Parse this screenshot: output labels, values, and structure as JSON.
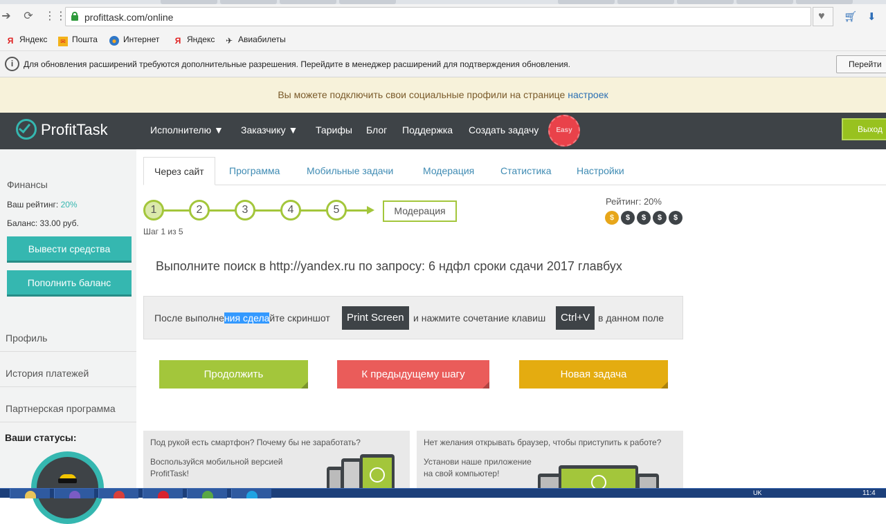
{
  "browser": {
    "url": "profittask.com/online",
    "bookmarks": [
      {
        "label": "Яндекс",
        "icon": "yandex-icon"
      },
      {
        "label": "Пошта",
        "icon": "mail-icon"
      },
      {
        "label": "Интернет",
        "icon": "internet-icon"
      },
      {
        "label": "Яндекс",
        "icon": "yandex-icon"
      },
      {
        "label": "Авиабилеты",
        "icon": "plane-icon"
      }
    ],
    "notice_text": "Для обновления расширений требуются дополнительные разрешения. Перейдите в менеджер расширений для подтверждения обновления.",
    "notice_button": "Перейти"
  },
  "banner": {
    "text": "Вы можете подключить свои социальные профили на странице ",
    "link": "настроек"
  },
  "header": {
    "logo": "ProfitTask",
    "menu": [
      "Исполнителю ▼",
      "Заказчику ▼",
      "Тарифы",
      "Блог",
      "Поддержка",
      "Создать задачу"
    ],
    "easy_badge": "Easy",
    "logout": "Выход"
  },
  "sidebar": {
    "finance_title": "Финансы",
    "rating_label": "Ваш рейтинг: ",
    "rating_value": "20%",
    "balance_label": "Баланс: ",
    "balance_value": "33.00 руб.",
    "withdraw_button": "Вывести средства",
    "topup_button": "Пополнить баланс",
    "links": [
      "Профиль",
      "История платежей",
      "Партнерская программа"
    ],
    "statuses_title": "Ваши статусы:"
  },
  "tabs": [
    "Через сайт",
    "Программа",
    "Мобильные задачи",
    "Модерация",
    "Статистика",
    "Настройки"
  ],
  "steps": {
    "numbers": [
      "1",
      "2",
      "3",
      "4",
      "5"
    ],
    "final": "Модерация",
    "counter": "Шаг 1 из 5"
  },
  "rating": {
    "label": "Рейтинг: 20%",
    "coin_symbol": "$",
    "coins_filled": 1,
    "coins_total": 5
  },
  "task": {
    "text": "Выполните поиск в http://yandex.ru по запросу: 6 ндфл сроки сдачи 2017 главбух"
  },
  "instruction": {
    "part1": "После выполне",
    "selected": "ния сдела",
    "part2": "йте скриншот",
    "key1": "Print Screen",
    "part3": "и нажмите сочетание клавиш",
    "key2": "Ctrl+V",
    "part4": "в данном поле"
  },
  "actions": {
    "continue": "Продолжить",
    "previous": "К предыдущему шагу",
    "new_task": "Новая задача"
  },
  "promos": [
    {
      "question": "Под рукой есть смартфон? Почему бы не заработать?",
      "desc_line1": "Воспользуйся мобильной версией",
      "desc_line2": "ProfitTask!"
    },
    {
      "question": "Нет желания открывать браузер, чтобы приступить к работе?",
      "desc_line1": "Установи наше приложение",
      "desc_line2": "на свой компьютер!"
    }
  ],
  "taskbar": {
    "tray": "UK",
    "clock": "11:4"
  },
  "colors": {
    "teal": "#35b7b0",
    "green": "#a3c63b",
    "red": "#ea5c5a",
    "amber": "#e4ac10",
    "header": "#3e4347"
  }
}
